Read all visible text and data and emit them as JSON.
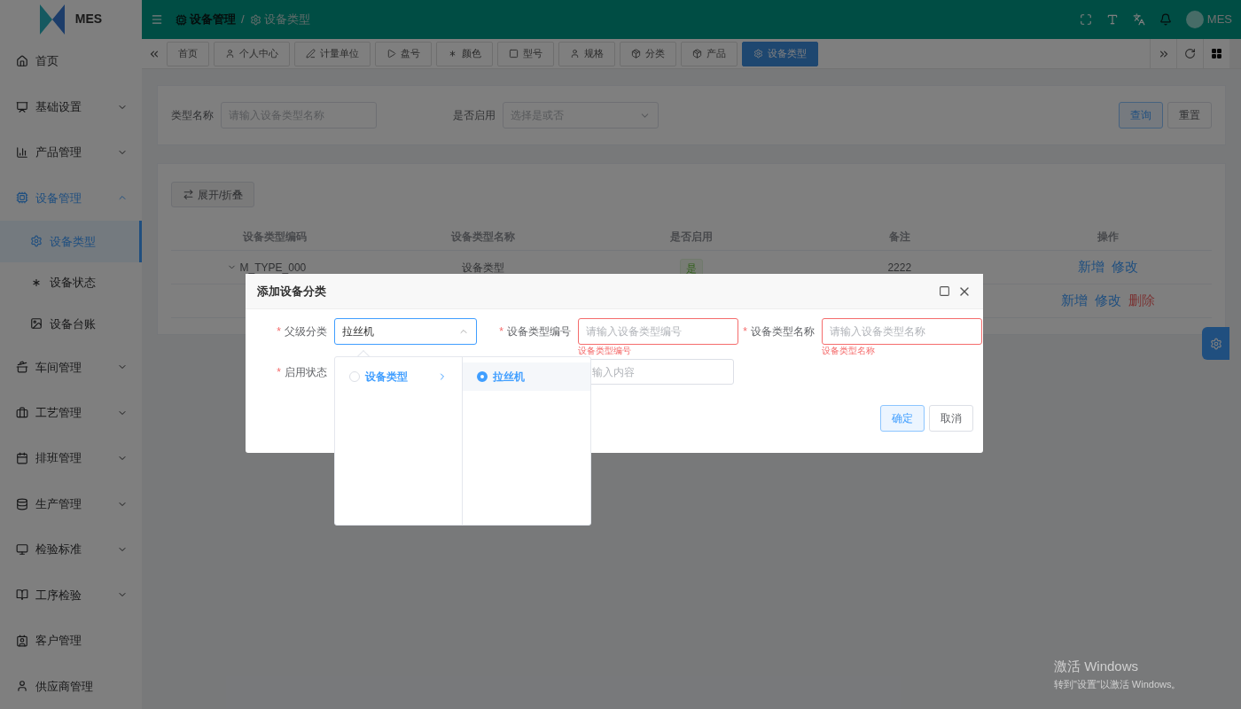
{
  "logo": {
    "text": "MES"
  },
  "header": {
    "breadcrumb": [
      "设备管理",
      "设备类型"
    ],
    "separator": "/",
    "user": "MES"
  },
  "sidebar": {
    "items": [
      {
        "label": "首页",
        "kind": "link",
        "selected": false
      },
      {
        "label": "基础设置",
        "kind": "group",
        "expanded": false,
        "selected": false
      },
      {
        "label": "产品管理",
        "kind": "group",
        "expanded": false,
        "selected": false
      },
      {
        "label": "设备管理",
        "kind": "group",
        "expanded": true,
        "selected": true,
        "children": [
          {
            "label": "设备类型",
            "selected": true
          },
          {
            "label": "设备状态",
            "selected": false
          },
          {
            "label": "设备台账",
            "selected": false
          }
        ]
      },
      {
        "label": "车间管理",
        "kind": "group",
        "expanded": false,
        "selected": false
      },
      {
        "label": "工艺管理",
        "kind": "group",
        "expanded": false,
        "selected": false
      },
      {
        "label": "排班管理",
        "kind": "group",
        "expanded": false,
        "selected": false
      },
      {
        "label": "生产管理",
        "kind": "group",
        "expanded": false,
        "selected": false
      },
      {
        "label": "检验标准",
        "kind": "group",
        "expanded": false,
        "selected": false
      },
      {
        "label": "工序检验",
        "kind": "group",
        "expanded": false,
        "selected": false
      },
      {
        "label": "客户管理",
        "kind": "link",
        "selected": false
      },
      {
        "label": "供应商管理",
        "kind": "link",
        "selected": false
      }
    ]
  },
  "tabs": [
    {
      "label": "首页",
      "selected": false
    },
    {
      "label": "个人中心",
      "selected": false
    },
    {
      "label": "计量单位",
      "selected": false
    },
    {
      "label": "盘号",
      "selected": false
    },
    {
      "label": "颜色",
      "selected": false
    },
    {
      "label": "型号",
      "selected": false
    },
    {
      "label": "规格",
      "selected": false
    },
    {
      "label": "分类",
      "selected": false
    },
    {
      "label": "产品",
      "selected": false
    },
    {
      "label": "设备类型",
      "selected": true
    }
  ],
  "search": {
    "fields": [
      {
        "label": "类型名称",
        "kind": "input",
        "placeholder": "请输入设备类型名称"
      },
      {
        "label": "是否启用",
        "kind": "select",
        "placeholder": "选择是或否"
      }
    ],
    "buttons": [
      {
        "label": "查询",
        "kind": "primary"
      },
      {
        "label": "重置",
        "kind": "default"
      }
    ]
  },
  "toolbar": {
    "expand_button": "展开/折叠"
  },
  "table": {
    "columns": [
      "设备类型编码",
      "设备类型名称",
      "是否启用",
      "备注",
      "操作"
    ],
    "rows": [
      {
        "code": "M_TYPE_000",
        "name": "设备类型",
        "enabled": "是",
        "remark": "2222",
        "expanded": true,
        "actions": [
          {
            "label": "新增",
            "kind": "normal"
          },
          {
            "label": "修改",
            "kind": "normal"
          }
        ]
      },
      {
        "actions": [
          {
            "label": "新增",
            "kind": "normal"
          },
          {
            "label": "修改",
            "kind": "normal"
          },
          {
            "label": "删除",
            "kind": "danger"
          }
        ]
      }
    ]
  },
  "dialog": {
    "title": "添加设备分类",
    "required_mark": "*",
    "row1": [
      {
        "label": "父级分类",
        "kind": "cascader",
        "value": "拉丝机",
        "open": true
      },
      {
        "label": "设备类型编号",
        "kind": "input",
        "placeholder": "请输入设备类型编号",
        "error": "设备类型编号"
      },
      {
        "label": "设备类型名称",
        "kind": "input",
        "placeholder": "请输入设备类型名称",
        "error": "设备类型名称"
      }
    ],
    "row2_label": "启用状态",
    "remark_placeholder": "输入内容",
    "buttons": [
      {
        "label": "确定",
        "kind": "primary"
      },
      {
        "label": "取消",
        "kind": "default"
      }
    ],
    "cascader": {
      "columns": [
        [
          {
            "label": "设备类型",
            "selected": false,
            "expanded": true,
            "has_children": true
          }
        ],
        [
          {
            "label": "拉丝机",
            "selected": true,
            "has_children": false
          }
        ]
      ]
    }
  },
  "os_notice": {
    "title": "激活 Windows",
    "subtitle": "转到\"设置\"以激活 Windows。"
  }
}
